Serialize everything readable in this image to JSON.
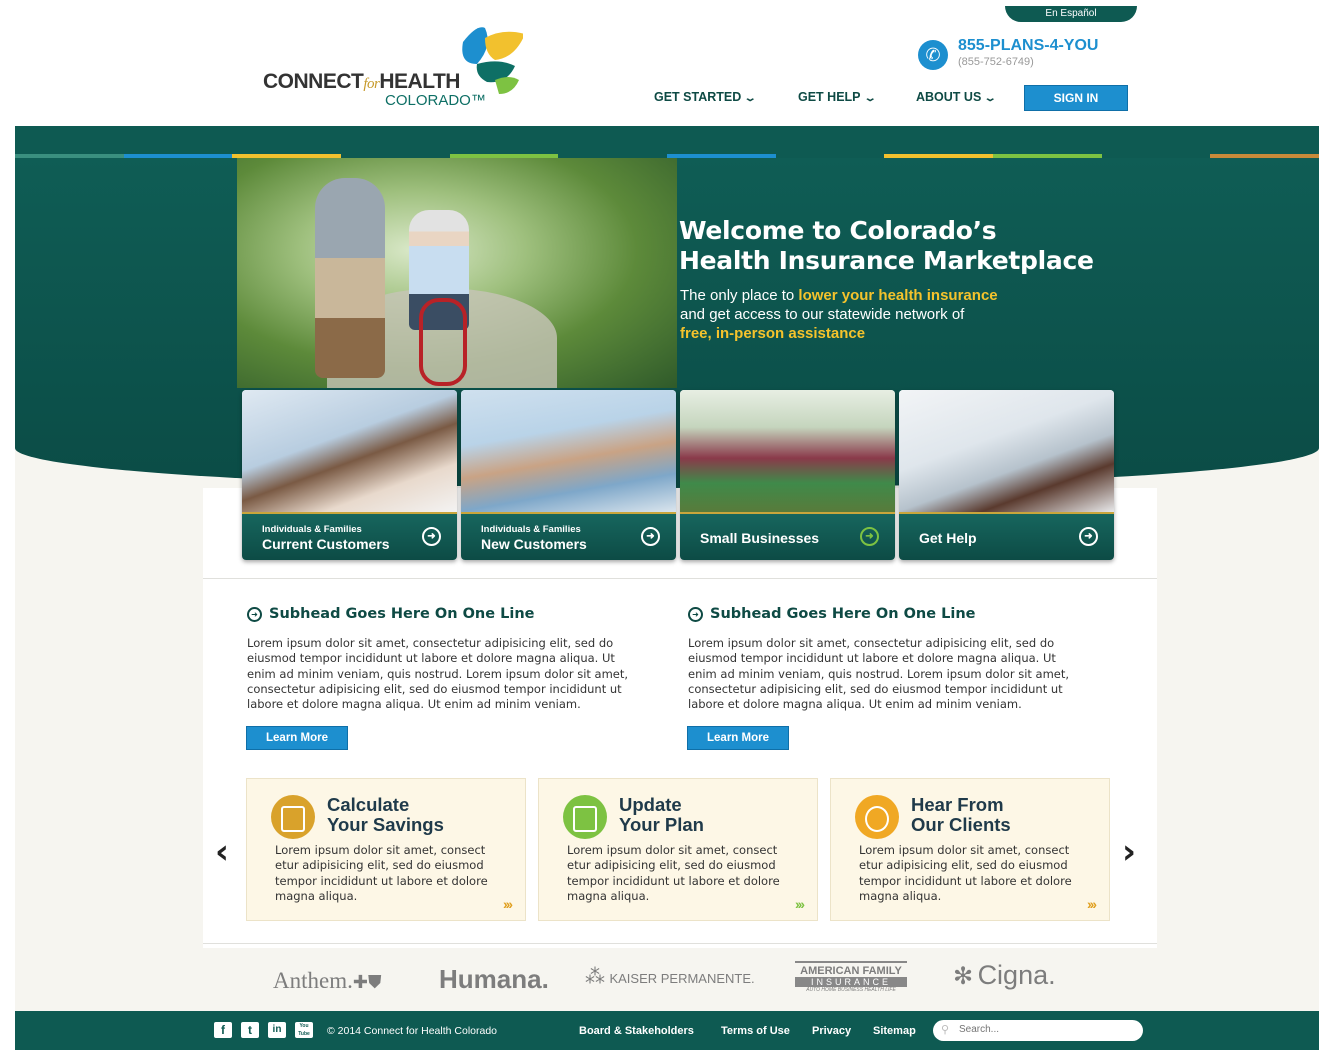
{
  "header": {
    "language_link": "En Español",
    "logo": {
      "connect": "CONNECT",
      "for": "for",
      "health": "HEALTH",
      "colorado": "COLORADO™"
    },
    "phone": {
      "main": "855-PLANS-4-YOU",
      "sub": "(855-752-6749)"
    },
    "nav": [
      {
        "label": "GET STARTED"
      },
      {
        "label": "GET HELP"
      },
      {
        "label": "ABOUT US"
      }
    ],
    "signin_label": "SIGN IN"
  },
  "colors": {
    "brand_teal": "#0e5a52",
    "accent_blue": "#1d8fcf",
    "accent_gold": "#f5c32c"
  },
  "hero": {
    "title_line1": "Welcome to Colorado’s",
    "title_line2": "Health Insurance Marketplace",
    "sub_a": "The only place to ",
    "sub_hl1": "lower your health insurance",
    "sub_b": "and get access to our statewide network of",
    "sub_hl2": "free, in-person assistance"
  },
  "cards": [
    {
      "eyebrow": "Individuals & Families",
      "label": "Current Customers"
    },
    {
      "eyebrow": "Individuals & Families",
      "label": "New Customers"
    },
    {
      "eyebrow": "",
      "label": "Small Businesses"
    },
    {
      "eyebrow": "",
      "label": "Get Help"
    }
  ],
  "subheads": [
    {
      "title": "Subhead Goes Here On One Line",
      "body": "Lorem ipsum dolor sit amet, consectetur adipisicing elit, sed do eiusmod tempor incididunt ut labore et dolore magna aliqua. Ut enim ad minim veniam, quis nostrud. Lorem ipsum dolor sit amet, consectetur adipisicing elit, sed do eiusmod tempor incididunt ut labore et dolore magna aliqua. Ut enim ad minim veniam.",
      "button": "Learn More"
    },
    {
      "title": "Subhead Goes Here On One Line",
      "body": "Lorem ipsum dolor sit amet, consectetur adipisicing elit, sed do eiusmod tempor incididunt ut labore et dolore magna aliqua. Ut enim ad minim veniam, quis nostrud. Lorem ipsum dolor sit amet, consectetur adipisicing elit, sed do eiusmod tempor incididunt ut labore et dolore magna aliqua. Ut enim ad minim veniam.",
      "button": "Learn More"
    }
  ],
  "features": [
    {
      "line1": "Calculate",
      "line2": "Your Savings",
      "text": "Lorem ipsum dolor sit amet, consect etur adipisicing elit, sed do eiusmod tempor incididunt ut labore et dolore magna aliqua.",
      "icon": "calculator-icon"
    },
    {
      "line1": "Update",
      "line2": "Your Plan",
      "text": "Lorem ipsum dolor sit amet, consect etur adipisicing elit, sed do eiusmod tempor incididunt ut labore et dolore magna aliqua.",
      "icon": "clipboard-icon"
    },
    {
      "line1": "Hear From",
      "line2": "Our Clients",
      "text": "Lorem ipsum dolor sit amet, consect etur adipisicing elit, sed do eiusmod tempor incididunt ut labore et dolore magna aliqua.",
      "icon": "speech-bubble-icon"
    }
  ],
  "carriers": {
    "anthem": "Anthem.",
    "humana": "Humana.",
    "kaiser": "KAISER PERMANENTE.",
    "amfam_top": "AMERICAN FAMILY",
    "amfam_mid": "INSURANCE",
    "amfam_bottom": "AUTO HOME BUSINESS HEALTH LIFE",
    "cigna": "Cigna."
  },
  "footer": {
    "social": [
      "f",
      "t",
      "in",
      "You Tube"
    ],
    "copyright": "© 2014 Connect for Health Colorado",
    "links": [
      "Board & Stakeholders",
      "Terms of Use",
      "Privacy",
      "Sitemap"
    ],
    "search_placeholder": "Search..."
  }
}
